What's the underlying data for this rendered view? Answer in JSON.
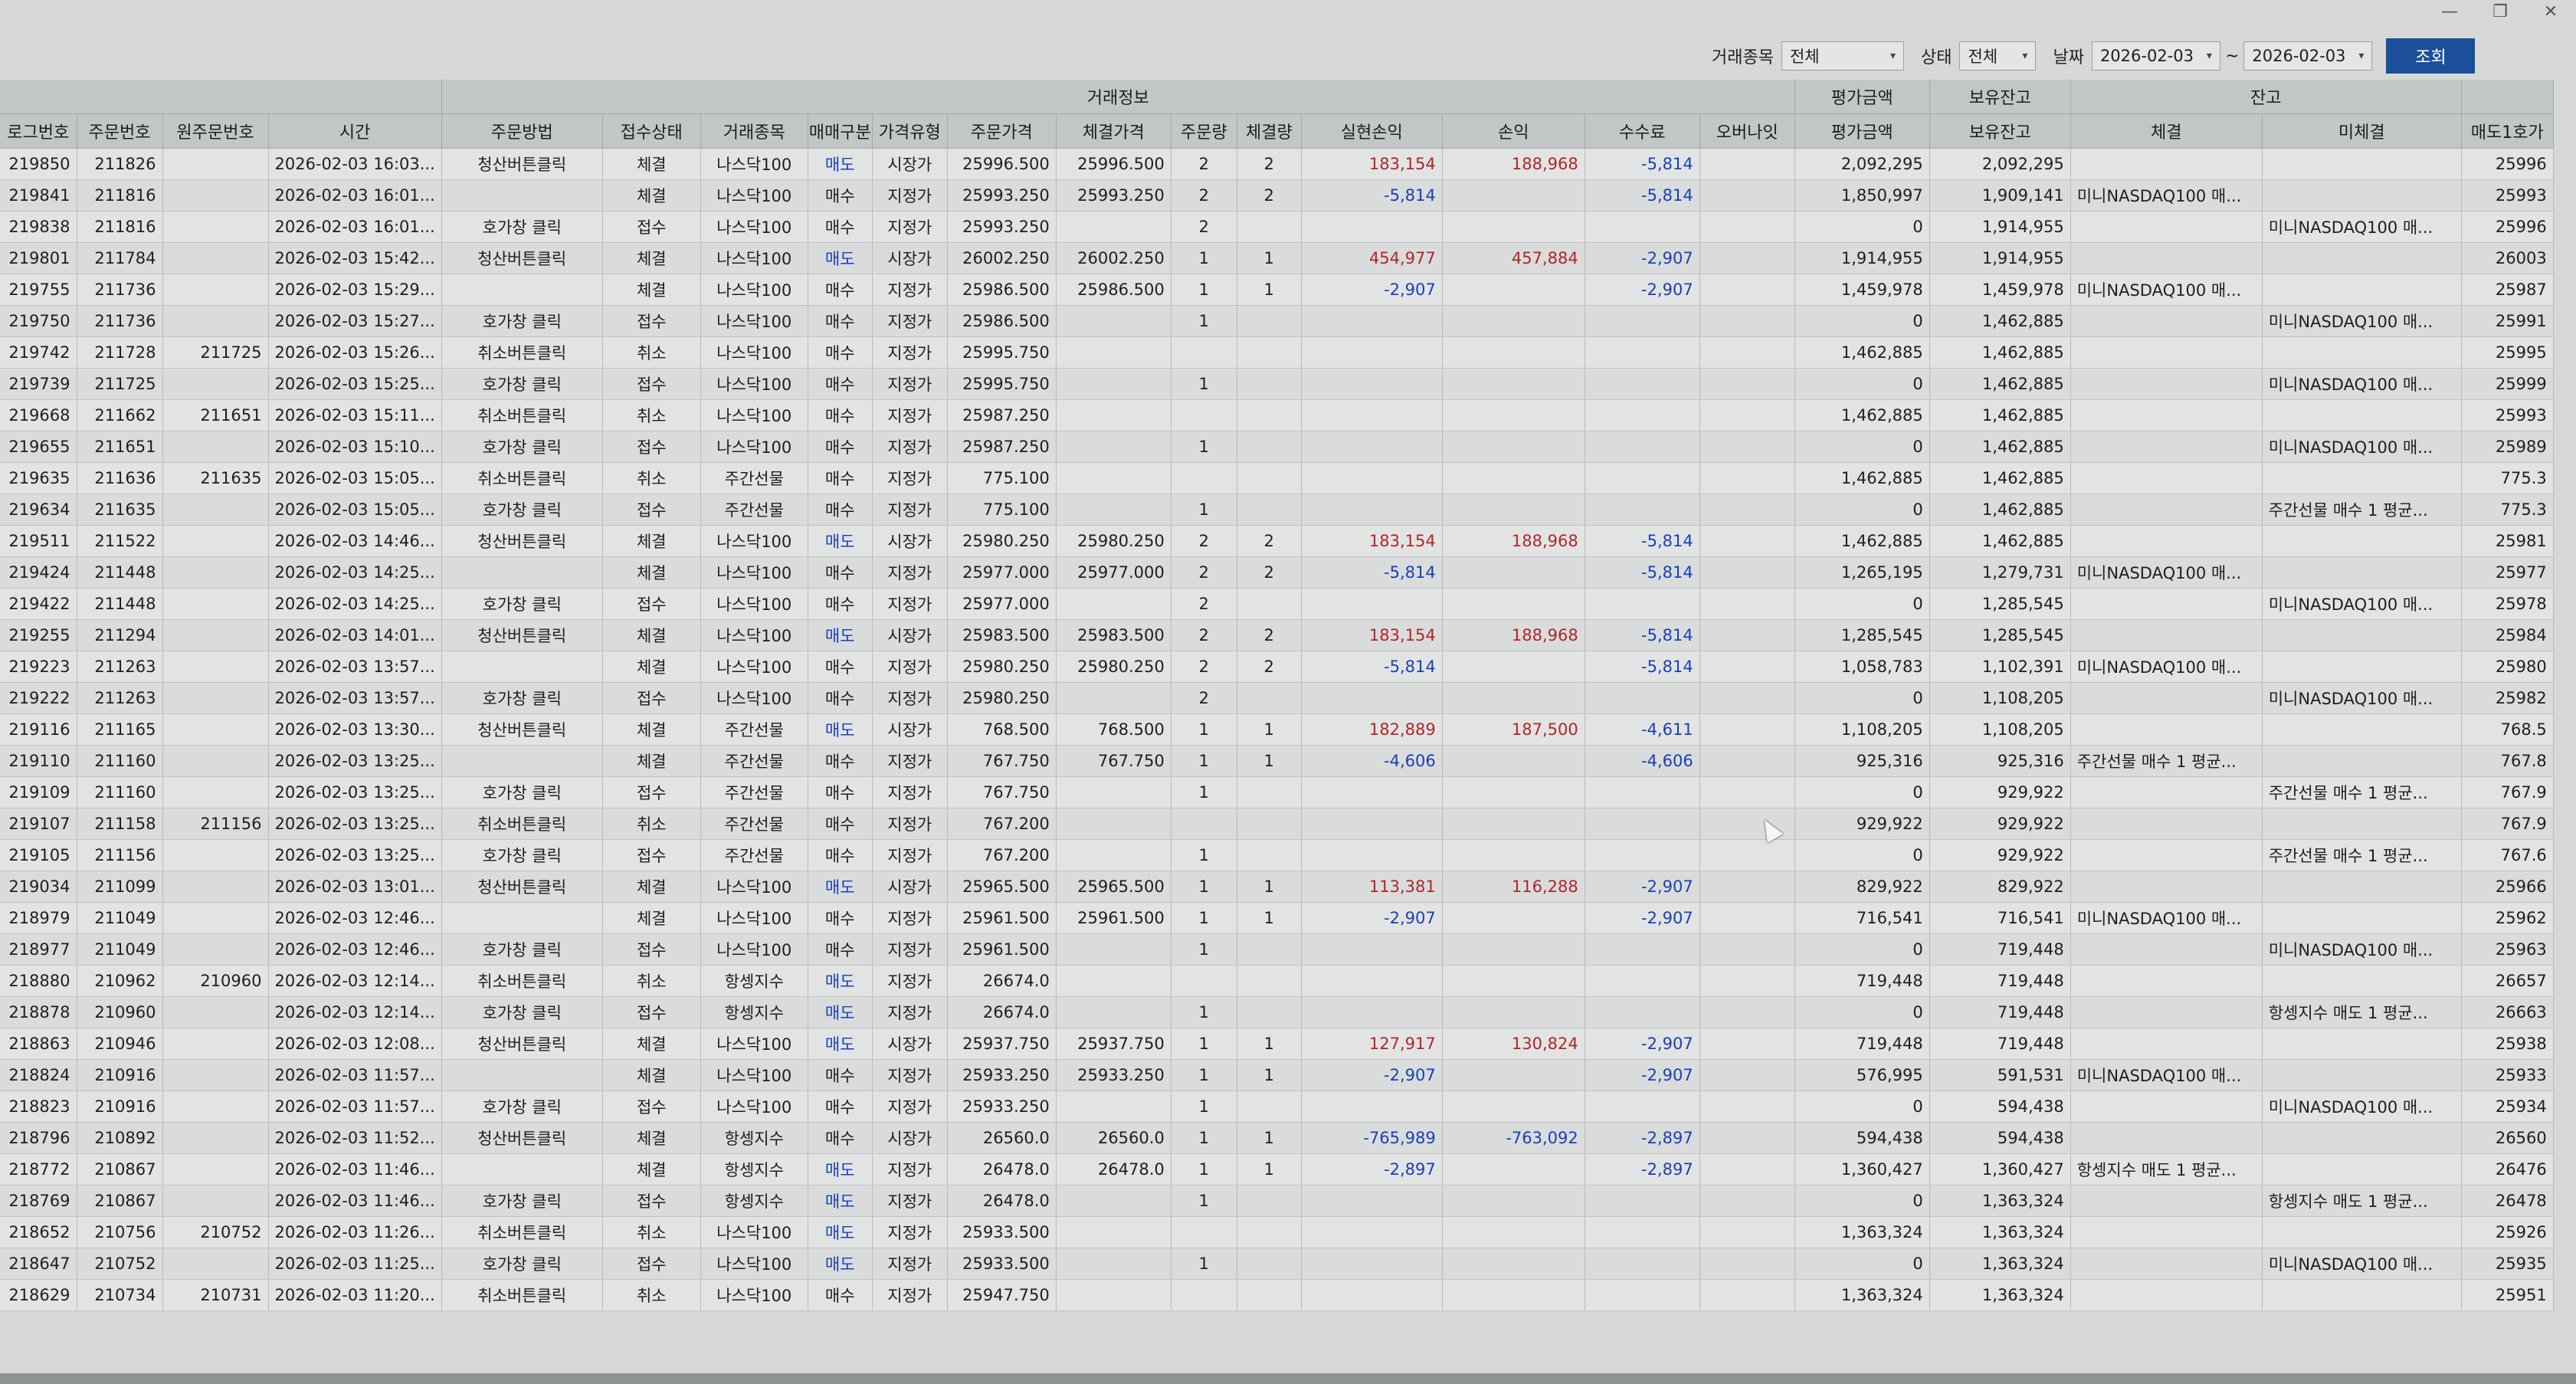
{
  "window": {
    "minimize_icon": "—",
    "restore_icon": "❐",
    "close_icon": "✕"
  },
  "filters": {
    "symbol_label": "거래종목",
    "symbol_value": "전체",
    "status_label": "상태",
    "status_value": "전체",
    "date_label": "날짜",
    "date_from": "2026-02-03",
    "date_sep": "~",
    "date_to": "2026-02-03",
    "search_label": "조회"
  },
  "groups": {
    "trade_info": "거래정보",
    "eval_top": "평가금액",
    "hold_top": "보유잔고",
    "balance": "잔고"
  },
  "columns": [
    "로그번호",
    "주문번호",
    "원주문번호",
    "시간",
    "주문방법",
    "접수상태",
    "거래종목",
    "매매구분",
    "가격유형",
    "주문가격",
    "체결가격",
    "주문량",
    "체결량",
    "실현손익",
    "손익",
    "수수료",
    "오버나잇",
    "평가금액",
    "보유잔고",
    "체결",
    "미체결",
    "매도1호가"
  ],
  "rows": [
    [
      "219850",
      "211826",
      "",
      "2026-02-03 16:03...",
      "청산버튼클릭",
      "체결",
      "나스닥100",
      "매도",
      "시장가",
      "25996.500",
      "25996.500",
      "2",
      "2",
      "183,154",
      "188,968",
      "-5,814",
      "",
      "2,092,295",
      "2,092,295",
      "",
      "",
      "25996"
    ],
    [
      "219841",
      "211816",
      "",
      "2026-02-03 16:01...",
      "",
      "체결",
      "나스닥100",
      "매수",
      "지정가",
      "25993.250",
      "25993.250",
      "2",
      "2",
      "-5,814",
      "",
      "-5,814",
      "",
      "1,850,997",
      "1,909,141",
      "미니NASDAQ100 매...",
      "",
      "25993"
    ],
    [
      "219838",
      "211816",
      "",
      "2026-02-03 16:01...",
      "호가창 클릭",
      "접수",
      "나스닥100",
      "매수",
      "지정가",
      "25993.250",
      "",
      "2",
      "",
      "",
      "",
      "",
      "",
      "0",
      "1,914,955",
      "",
      "미니NASDAQ100 매...",
      "25996"
    ],
    [
      "219801",
      "211784",
      "",
      "2026-02-03 15:42...",
      "청산버튼클릭",
      "체결",
      "나스닥100",
      "매도",
      "시장가",
      "26002.250",
      "26002.250",
      "1",
      "1",
      "454,977",
      "457,884",
      "-2,907",
      "",
      "1,914,955",
      "1,914,955",
      "",
      "",
      "26003"
    ],
    [
      "219755",
      "211736",
      "",
      "2026-02-03 15:29...",
      "",
      "체결",
      "나스닥100",
      "매수",
      "지정가",
      "25986.500",
      "25986.500",
      "1",
      "1",
      "-2,907",
      "",
      "-2,907",
      "",
      "1,459,978",
      "1,459,978",
      "미니NASDAQ100 매...",
      "",
      "25987"
    ],
    [
      "219750",
      "211736",
      "",
      "2026-02-03 15:27...",
      "호가창 클릭",
      "접수",
      "나스닥100",
      "매수",
      "지정가",
      "25986.500",
      "",
      "1",
      "",
      "",
      "",
      "",
      "",
      "0",
      "1,462,885",
      "",
      "미니NASDAQ100 매...",
      "25991"
    ],
    [
      "219742",
      "211728",
      "211725",
      "2026-02-03 15:26...",
      "취소버튼클릭",
      "취소",
      "나스닥100",
      "매수",
      "지정가",
      "25995.750",
      "",
      "",
      "",
      "",
      "",
      "",
      "",
      "1,462,885",
      "1,462,885",
      "",
      "",
      "25995"
    ],
    [
      "219739",
      "211725",
      "",
      "2026-02-03 15:25...",
      "호가창 클릭",
      "접수",
      "나스닥100",
      "매수",
      "지정가",
      "25995.750",
      "",
      "1",
      "",
      "",
      "",
      "",
      "",
      "0",
      "1,462,885",
      "",
      "미니NASDAQ100 매...",
      "25999"
    ],
    [
      "219668",
      "211662",
      "211651",
      "2026-02-03 15:11...",
      "취소버튼클릭",
      "취소",
      "나스닥100",
      "매수",
      "지정가",
      "25987.250",
      "",
      "",
      "",
      "",
      "",
      "",
      "",
      "1,462,885",
      "1,462,885",
      "",
      "",
      "25993"
    ],
    [
      "219655",
      "211651",
      "",
      "2026-02-03 15:10...",
      "호가창 클릭",
      "접수",
      "나스닥100",
      "매수",
      "지정가",
      "25987.250",
      "",
      "1",
      "",
      "",
      "",
      "",
      "",
      "0",
      "1,462,885",
      "",
      "미니NASDAQ100 매...",
      "25989"
    ],
    [
      "219635",
      "211636",
      "211635",
      "2026-02-03 15:05...",
      "취소버튼클릭",
      "취소",
      "주간선물",
      "매수",
      "지정가",
      "775.100",
      "",
      "",
      "",
      "",
      "",
      "",
      "",
      "1,462,885",
      "1,462,885",
      "",
      "",
      "775.3"
    ],
    [
      "219634",
      "211635",
      "",
      "2026-02-03 15:05...",
      "호가창 클릭",
      "접수",
      "주간선물",
      "매수",
      "지정가",
      "775.100",
      "",
      "1",
      "",
      "",
      "",
      "",
      "",
      "0",
      "1,462,885",
      "",
      "주간선물 매수 1 평균...",
      "775.3"
    ],
    [
      "219511",
      "211522",
      "",
      "2026-02-03 14:46...",
      "청산버튼클릭",
      "체결",
      "나스닥100",
      "매도",
      "시장가",
      "25980.250",
      "25980.250",
      "2",
      "2",
      "183,154",
      "188,968",
      "-5,814",
      "",
      "1,462,885",
      "1,462,885",
      "",
      "",
      "25981"
    ],
    [
      "219424",
      "211448",
      "",
      "2026-02-03 14:25...",
      "",
      "체결",
      "나스닥100",
      "매수",
      "지정가",
      "25977.000",
      "25977.000",
      "2",
      "2",
      "-5,814",
      "",
      "-5,814",
      "",
      "1,265,195",
      "1,279,731",
      "미니NASDAQ100 매...",
      "",
      "25977"
    ],
    [
      "219422",
      "211448",
      "",
      "2026-02-03 14:25...",
      "호가창 클릭",
      "접수",
      "나스닥100",
      "매수",
      "지정가",
      "25977.000",
      "",
      "2",
      "",
      "",
      "",
      "",
      "",
      "0",
      "1,285,545",
      "",
      "미니NASDAQ100 매...",
      "25978"
    ],
    [
      "219255",
      "211294",
      "",
      "2026-02-03 14:01...",
      "청산버튼클릭",
      "체결",
      "나스닥100",
      "매도",
      "시장가",
      "25983.500",
      "25983.500",
      "2",
      "2",
      "183,154",
      "188,968",
      "-5,814",
      "",
      "1,285,545",
      "1,285,545",
      "",
      "",
      "25984"
    ],
    [
      "219223",
      "211263",
      "",
      "2026-02-03 13:57...",
      "",
      "체결",
      "나스닥100",
      "매수",
      "지정가",
      "25980.250",
      "25980.250",
      "2",
      "2",
      "-5,814",
      "",
      "-5,814",
      "",
      "1,058,783",
      "1,102,391",
      "미니NASDAQ100 매...",
      "",
      "25980"
    ],
    [
      "219222",
      "211263",
      "",
      "2026-02-03 13:57...",
      "호가창 클릭",
      "접수",
      "나스닥100",
      "매수",
      "지정가",
      "25980.250",
      "",
      "2",
      "",
      "",
      "",
      "",
      "",
      "0",
      "1,108,205",
      "",
      "미니NASDAQ100 매...",
      "25982"
    ],
    [
      "219116",
      "211165",
      "",
      "2026-02-03 13:30...",
      "청산버튼클릭",
      "체결",
      "주간선물",
      "매도",
      "시장가",
      "768.500",
      "768.500",
      "1",
      "1",
      "182,889",
      "187,500",
      "-4,611",
      "",
      "1,108,205",
      "1,108,205",
      "",
      "",
      "768.5"
    ],
    [
      "219110",
      "211160",
      "",
      "2026-02-03 13:25...",
      "",
      "체결",
      "주간선물",
      "매수",
      "지정가",
      "767.750",
      "767.750",
      "1",
      "1",
      "-4,606",
      "",
      "-4,606",
      "",
      "925,316",
      "925,316",
      "주간선물 매수 1 평균...",
      "",
      "767.8"
    ],
    [
      "219109",
      "211160",
      "",
      "2026-02-03 13:25...",
      "호가창 클릭",
      "접수",
      "주간선물",
      "매수",
      "지정가",
      "767.750",
      "",
      "1",
      "",
      "",
      "",
      "",
      "",
      "0",
      "929,922",
      "",
      "주간선물 매수 1 평균...",
      "767.9"
    ],
    [
      "219107",
      "211158",
      "211156",
      "2026-02-03 13:25...",
      "취소버튼클릭",
      "취소",
      "주간선물",
      "매수",
      "지정가",
      "767.200",
      "",
      "",
      "",
      "",
      "",
      "",
      "",
      "929,922",
      "929,922",
      "",
      "",
      "767.9"
    ],
    [
      "219105",
      "211156",
      "",
      "2026-02-03 13:25...",
      "호가창 클릭",
      "접수",
      "주간선물",
      "매수",
      "지정가",
      "767.200",
      "",
      "1",
      "",
      "",
      "",
      "",
      "",
      "0",
      "929,922",
      "",
      "주간선물 매수 1 평균...",
      "767.6"
    ],
    [
      "219034",
      "211099",
      "",
      "2026-02-03 13:01...",
      "청산버튼클릭",
      "체결",
      "나스닥100",
      "매도",
      "시장가",
      "25965.500",
      "25965.500",
      "1",
      "1",
      "113,381",
      "116,288",
      "-2,907",
      "",
      "829,922",
      "829,922",
      "",
      "",
      "25966"
    ],
    [
      "218979",
      "211049",
      "",
      "2026-02-03 12:46...",
      "",
      "체결",
      "나스닥100",
      "매수",
      "지정가",
      "25961.500",
      "25961.500",
      "1",
      "1",
      "-2,907",
      "",
      "-2,907",
      "",
      "716,541",
      "716,541",
      "미니NASDAQ100 매...",
      "",
      "25962"
    ],
    [
      "218977",
      "211049",
      "",
      "2026-02-03 12:46...",
      "호가창 클릭",
      "접수",
      "나스닥100",
      "매수",
      "지정가",
      "25961.500",
      "",
      "1",
      "",
      "",
      "",
      "",
      "",
      "0",
      "719,448",
      "",
      "미니NASDAQ100 매...",
      "25963"
    ],
    [
      "218880",
      "210962",
      "210960",
      "2026-02-03 12:14...",
      "취소버튼클릭",
      "취소",
      "항셍지수",
      "매도",
      "지정가",
      "26674.0",
      "",
      "",
      "",
      "",
      "",
      "",
      "",
      "719,448",
      "719,448",
      "",
      "",
      "26657"
    ],
    [
      "218878",
      "210960",
      "",
      "2026-02-03 12:14...",
      "호가창 클릭",
      "접수",
      "항셍지수",
      "매도",
      "지정가",
      "26674.0",
      "",
      "1",
      "",
      "",
      "",
      "",
      "",
      "0",
      "719,448",
      "",
      "항셍지수 매도 1 평균...",
      "26663"
    ],
    [
      "218863",
      "210946",
      "",
      "2026-02-03 12:08...",
      "청산버튼클릭",
      "체결",
      "나스닥100",
      "매도",
      "시장가",
      "25937.750",
      "25937.750",
      "1",
      "1",
      "127,917",
      "130,824",
      "-2,907",
      "",
      "719,448",
      "719,448",
      "",
      "",
      "25938"
    ],
    [
      "218824",
      "210916",
      "",
      "2026-02-03 11:57...",
      "",
      "체결",
      "나스닥100",
      "매수",
      "지정가",
      "25933.250",
      "25933.250",
      "1",
      "1",
      "-2,907",
      "",
      "-2,907",
      "",
      "576,995",
      "591,531",
      "미니NASDAQ100 매...",
      "",
      "25933"
    ],
    [
      "218823",
      "210916",
      "",
      "2026-02-03 11:57...",
      "호가창 클릭",
      "접수",
      "나스닥100",
      "매수",
      "지정가",
      "25933.250",
      "",
      "1",
      "",
      "",
      "",
      "",
      "",
      "0",
      "594,438",
      "",
      "미니NASDAQ100 매...",
      "25934"
    ],
    [
      "218796",
      "210892",
      "",
      "2026-02-03 11:52...",
      "청산버튼클릭",
      "체결",
      "항셍지수",
      "매수",
      "시장가",
      "26560.0",
      "26560.0",
      "1",
      "1",
      "-765,989",
      "-763,092",
      "-2,897",
      "",
      "594,438",
      "594,438",
      "",
      "",
      "26560"
    ],
    [
      "218772",
      "210867",
      "",
      "2026-02-03 11:46...",
      "",
      "체결",
      "항셍지수",
      "매도",
      "지정가",
      "26478.0",
      "26478.0",
      "1",
      "1",
      "-2,897",
      "",
      "-2,897",
      "",
      "1,360,427",
      "1,360,427",
      "항셍지수 매도 1 평균...",
      "",
      "26476"
    ],
    [
      "218769",
      "210867",
      "",
      "2026-02-03 11:46...",
      "호가창 클릭",
      "접수",
      "항셍지수",
      "매도",
      "지정가",
      "26478.0",
      "",
      "1",
      "",
      "",
      "",
      "",
      "",
      "0",
      "1,363,324",
      "",
      "항셍지수 매도 1 평균...",
      "26478"
    ],
    [
      "218652",
      "210756",
      "210752",
      "2026-02-03 11:26...",
      "취소버튼클릭",
      "취소",
      "나스닥100",
      "매도",
      "지정가",
      "25933.500",
      "",
      "",
      "",
      "",
      "",
      "",
      "",
      "1,363,324",
      "1,363,324",
      "",
      "",
      "25926"
    ],
    [
      "218647",
      "210752",
      "",
      "2026-02-03 11:25...",
      "호가창 클릭",
      "접수",
      "나스닥100",
      "매도",
      "지정가",
      "25933.500",
      "",
      "1",
      "",
      "",
      "",
      "",
      "",
      "0",
      "1,363,324",
      "",
      "미니NASDAQ100 매...",
      "25935"
    ],
    [
      "218629",
      "210734",
      "210731",
      "2026-02-03 11:20...",
      "취소버튼클릭",
      "취소",
      "나스닥100",
      "매수",
      "지정가",
      "25947.750",
      "",
      "",
      "",
      "",
      "",
      "",
      "",
      "1,363,324",
      "1,363,324",
      "",
      "",
      "25951"
    ]
  ]
}
